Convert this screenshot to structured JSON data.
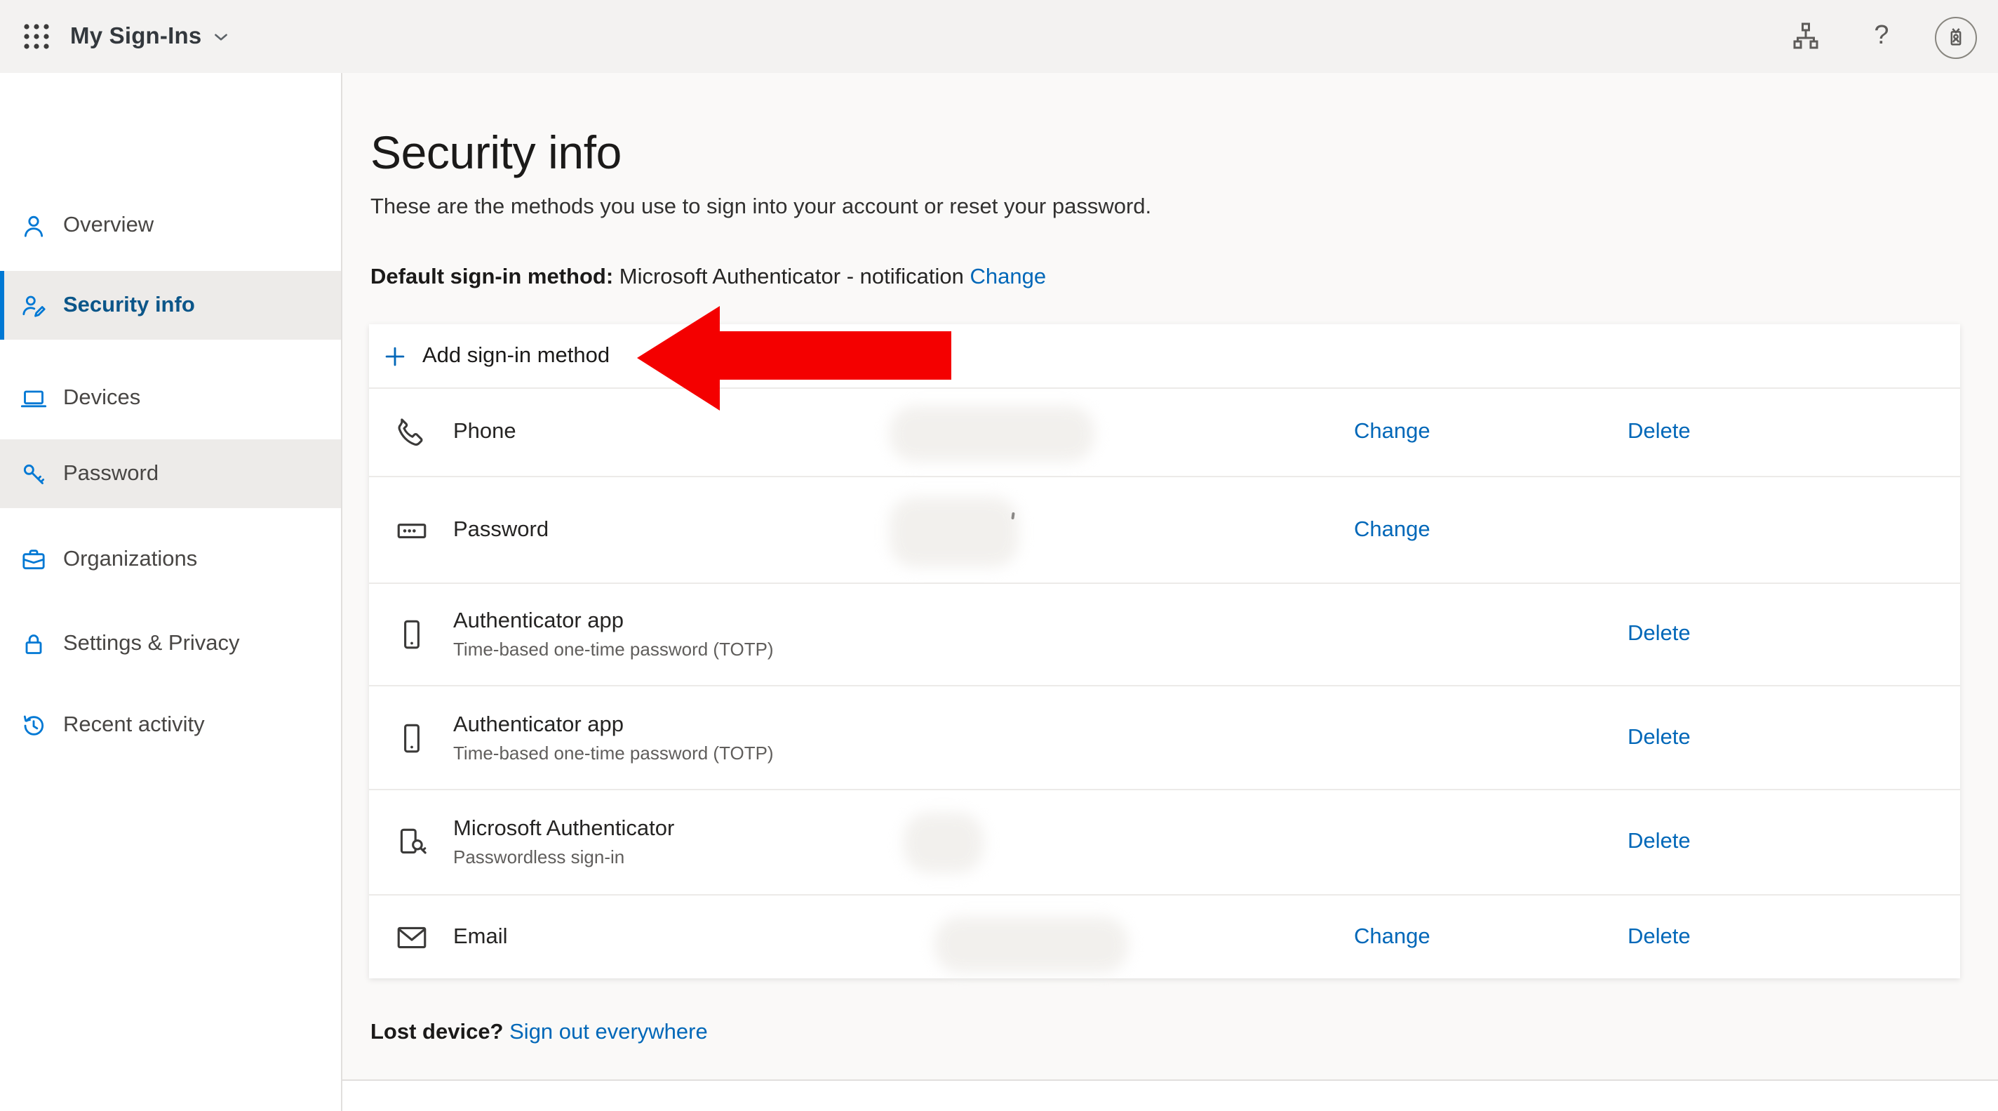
{
  "topbar": {
    "title": "My Sign-Ins",
    "help_glyph": "?",
    "icons": {
      "app_launcher": "waffle-grid",
      "organization": "org-chart",
      "help": "question-mark",
      "account": "id-badge-avatar"
    }
  },
  "sidebar": {
    "items": [
      {
        "label": "Overview",
        "icon": "person",
        "selected": false
      },
      {
        "label": "Security info",
        "icon": "person-key",
        "selected": true
      },
      {
        "label": "Devices",
        "icon": "laptop",
        "selected": false
      },
      {
        "label": "Password",
        "icon": "key",
        "selected": false,
        "hovered": true
      },
      {
        "label": "Organizations",
        "icon": "briefcase",
        "selected": false
      },
      {
        "label": "Settings & Privacy",
        "icon": "lock",
        "selected": false
      },
      {
        "label": "Recent activity",
        "icon": "history-clock",
        "selected": false
      }
    ]
  },
  "main": {
    "title": "Security info",
    "description": "These are the methods you use to sign into your account or reset your password.",
    "default_method": {
      "label": "Default sign-in method:",
      "value": " Microsoft Authenticator - notification ",
      "change_label": "Change"
    },
    "add_method_label": "Add sign-in method",
    "links": {
      "change": "Change",
      "delete": "Delete"
    },
    "methods": [
      {
        "name": "Phone",
        "secondary": "",
        "icon": "phone-handset",
        "value_redacted": true,
        "actions": [
          "Change",
          "Delete"
        ]
      },
      {
        "name": "Password",
        "secondary": "",
        "icon": "password-field",
        "value_redacted": true,
        "actions": [
          "Change"
        ]
      },
      {
        "name": "Authenticator app",
        "secondary": "Time-based one-time password (TOTP)",
        "icon": "smartphone",
        "value_redacted": false,
        "actions": [
          "Delete"
        ]
      },
      {
        "name": "Authenticator app",
        "secondary": "Time-based one-time password (TOTP)",
        "icon": "smartphone",
        "value_redacted": false,
        "actions": [
          "Delete"
        ]
      },
      {
        "name": "Microsoft Authenticator",
        "secondary": "Passwordless sign-in",
        "icon": "authenticator-phone-key",
        "value_redacted": true,
        "actions": [
          "Delete"
        ]
      },
      {
        "name": "Email",
        "secondary": "",
        "icon": "envelope",
        "value_redacted": true,
        "actions": [
          "Change",
          "Delete"
        ]
      }
    ],
    "lost_device": {
      "label": "Lost device?",
      "link_label": "Sign out everywhere"
    },
    "annotation": {
      "type": "red-arrow-pointing-left",
      "target": "Add sign-in method"
    }
  },
  "colors": {
    "accent_blue": "#0078d4",
    "link_blue": "#0067b8",
    "selected_text_blue": "#0b5689",
    "arrow_red": "#f40000",
    "topbar_bg": "#f3f2f1",
    "content_bg": "#faf9f8",
    "selected_bg": "#edebe9"
  }
}
